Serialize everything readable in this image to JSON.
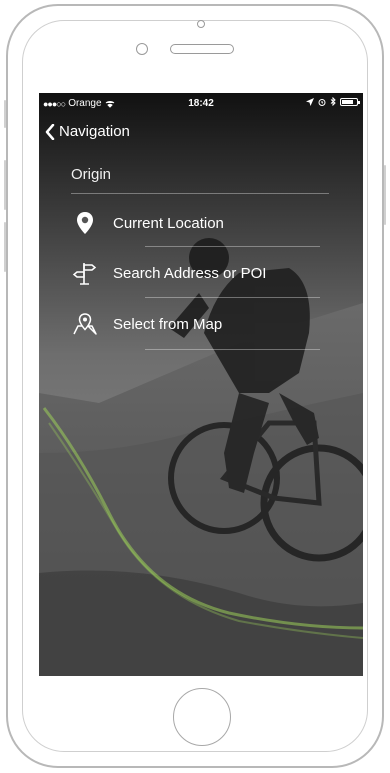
{
  "status_bar": {
    "carrier": "Orange",
    "time": "18:42",
    "battery_level": 0.8
  },
  "nav": {
    "back_label": "Navigation"
  },
  "origin": {
    "header": "Origin",
    "items": [
      {
        "label": "Current Location",
        "icon": "location-pin-icon"
      },
      {
        "label": "Search Address or POI",
        "icon": "signpost-icon"
      },
      {
        "label": "Select from Map",
        "icon": "map-pin-icon"
      }
    ]
  },
  "colors": {
    "status_text": "#ffffff",
    "nav_background": "#000000",
    "accent_trail": "#9ccf5a"
  }
}
